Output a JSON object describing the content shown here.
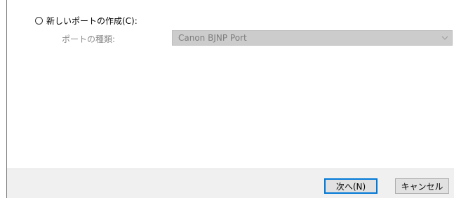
{
  "create_port": {
    "radio_label": "新しいポートの作成(C):",
    "selected": false
  },
  "port_type": {
    "label": "ポートの種類:",
    "value": "Canon BJNP Port",
    "enabled": false
  },
  "icons": {
    "dropdown": "chevron-down-icon"
  },
  "buttons": {
    "next_label": "次へ(N)",
    "cancel_label": "キャンセル"
  },
  "colors": {
    "accent": "#0078d7",
    "disabled_fill": "#cccccc",
    "footer_bg": "#f0f0f0"
  }
}
